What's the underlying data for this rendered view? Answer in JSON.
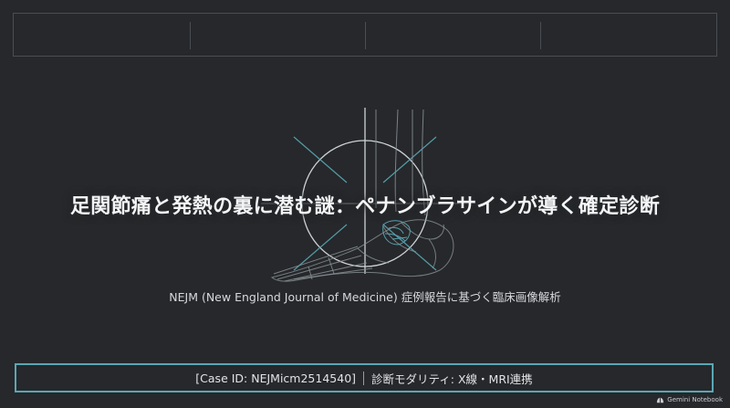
{
  "slide": {
    "title": "足関節痛と発熱の裏に潜む謎：ペナンブラサインが導く確定診断",
    "subtitle": "NEJM (New England Journal of Medicine) 症例報告に基づく臨床画像解析",
    "case_id": "[Case ID: NEJMicm2514540]",
    "modality": "診断モダリティ: X線・MRI連携"
  },
  "branding": {
    "label": "Gemini Notebook",
    "icon": "gemini-notebook-icon"
  },
  "colors": {
    "background": "#26282b",
    "accent": "#5aa7b5",
    "frame_line": "#4a4e53",
    "title_text": "#f4f5f6"
  }
}
